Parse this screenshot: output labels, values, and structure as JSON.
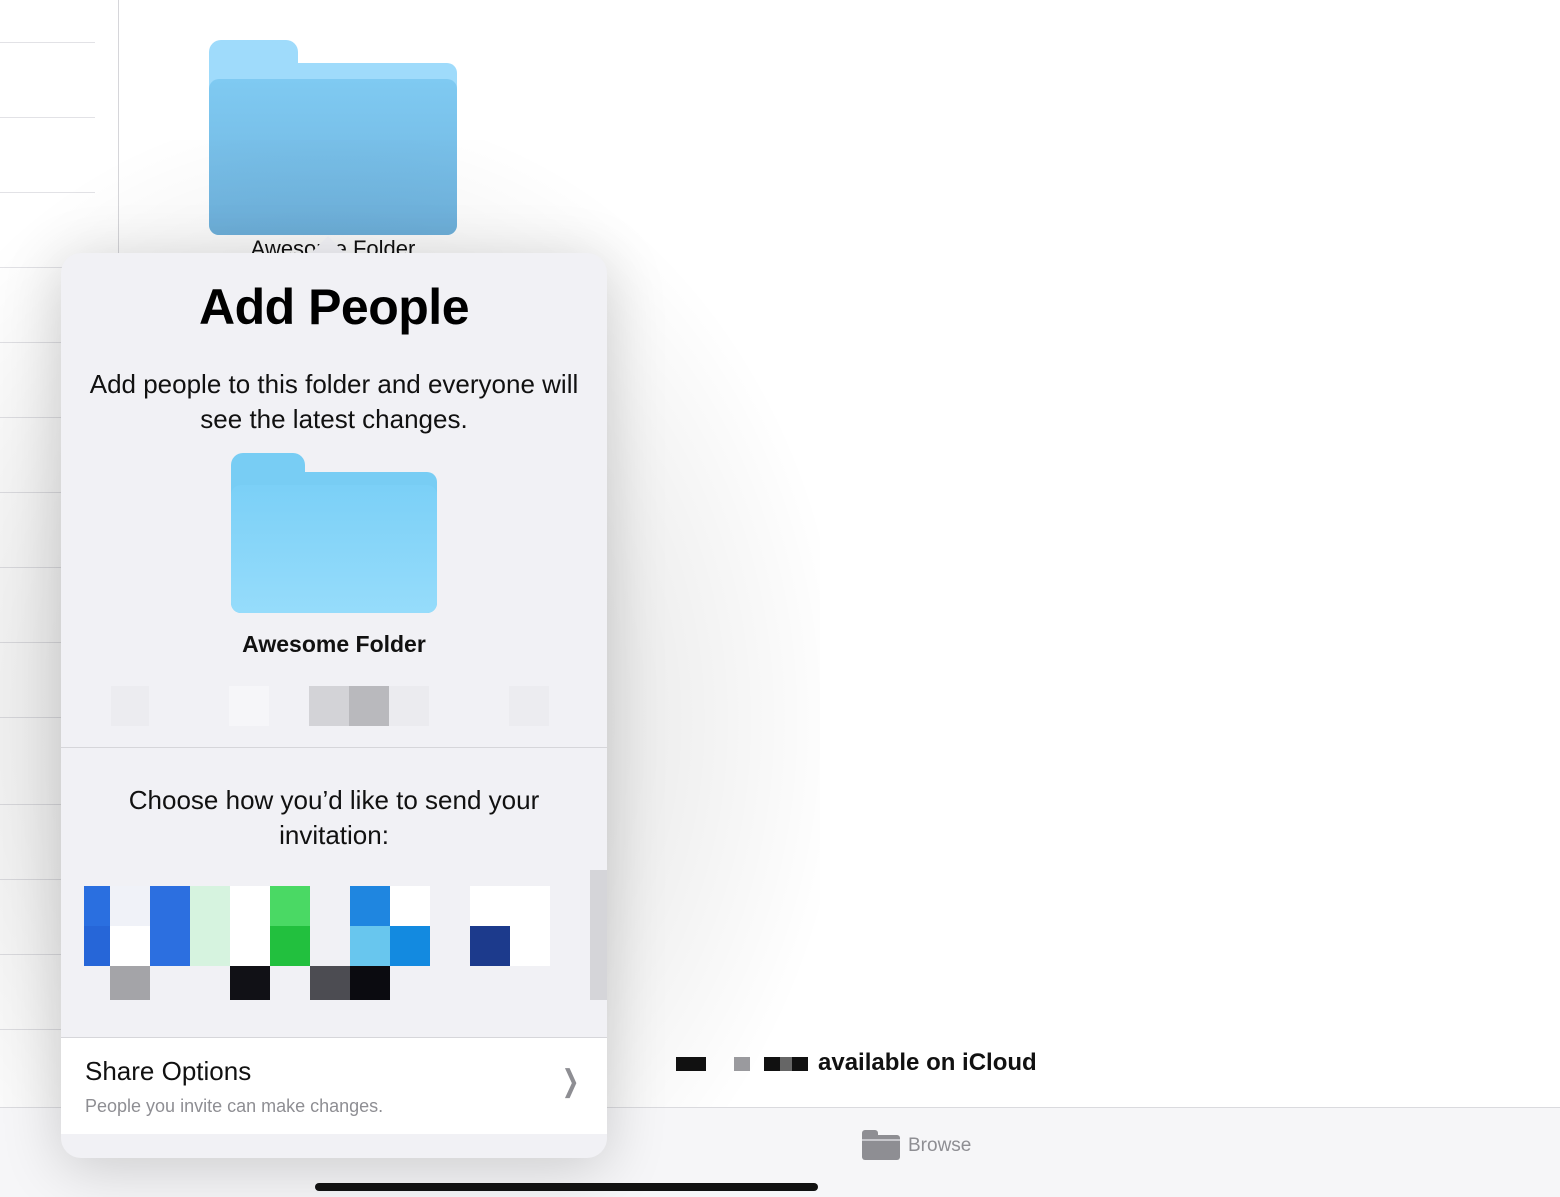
{
  "background_folder": {
    "label": "Awesome Folder",
    "color": "#9fdbfb"
  },
  "popover": {
    "title": "Add People",
    "description": "Add people to this folder and everyone will see the latest changes.",
    "folder_name": "Awesome Folder",
    "choose_prompt": "Choose how you’d like to send your invitation:",
    "share_options": {
      "title": "Share Options",
      "subtitle": "People you invite can make changes.",
      "chevron_icon": "chevron-right-icon"
    }
  },
  "status": {
    "text": "available on iCloud"
  },
  "tabbar": {
    "browse_label": "Browse",
    "browse_icon": "folder-icon"
  },
  "colors": {
    "popover_bg": "#f1f1f5",
    "folder_blue": "#78cdf4",
    "secondary_text": "#8e8e93"
  }
}
